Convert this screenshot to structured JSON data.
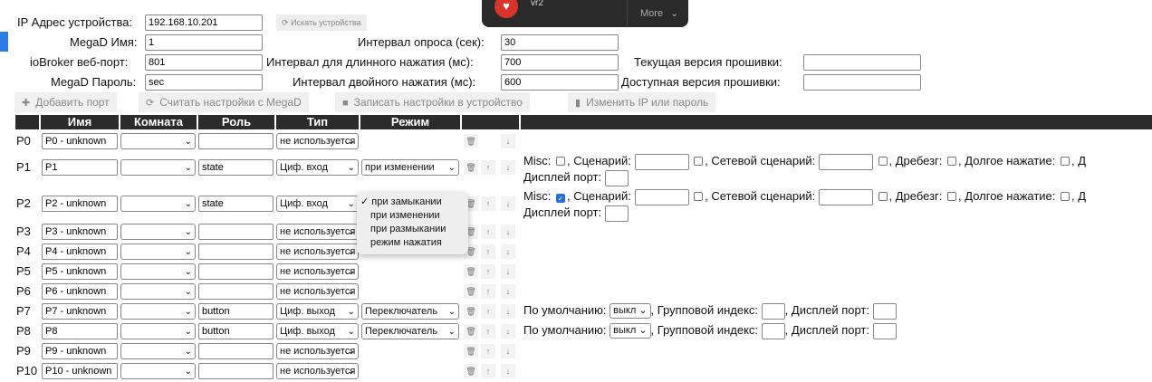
{
  "settings": {
    "ip_label": "IP Адрес устройства:",
    "ip_value": "192.168.10.201",
    "search_label": "Искать устройства",
    "name_label": "MegaD Имя:",
    "name_value": "1",
    "iobroker_label": "ioBroker веб-порт:",
    "iobroker_value": "801",
    "password_label": "MegaD Пароль:",
    "password_value": "sec",
    "poll_label": "Интервал опроса (сек):",
    "poll_value": "30",
    "long_label": "Интервал для длинного нажатия (мс):",
    "long_value": "700",
    "double_label": "Интервал двойного нажатия (мс):",
    "double_value": "600",
    "fw_current_label": "Текущая версия прошивки:",
    "fw_current_value": "",
    "fw_available_label": "Доступная версия прошивки:",
    "fw_available_value": ""
  },
  "toolbar": {
    "add_port": "Добавить порт",
    "read_settings": "Считать настройки с MegaD",
    "write_settings": "Записать настройки в устройство",
    "change_ip": "Изменить IP или пароль"
  },
  "notification": {
    "title": "vr2",
    "more": "More"
  },
  "table": {
    "headers": [
      "Имя",
      "Комната",
      "Роль",
      "Тип",
      "Режим"
    ],
    "rows": [
      {
        "port": "P0",
        "name": "P0 - unknown",
        "role": "",
        "type": "не используется",
        "mode": ""
      },
      {
        "port": "P1",
        "name": "P1",
        "role": "state",
        "type": "Циф. вход",
        "mode": "при изменении"
      },
      {
        "port": "P2",
        "name": "P2 - unknown",
        "role": "state",
        "type": "Циф. вход",
        "mode": ""
      },
      {
        "port": "P3",
        "name": "P3 - unknown",
        "role": "",
        "type": "не используется",
        "mode": ""
      },
      {
        "port": "P4",
        "name": "P4 - unknown",
        "role": "",
        "type": "не используется",
        "mode": ""
      },
      {
        "port": "P5",
        "name": "P5 - unknown",
        "role": "",
        "type": "не используется",
        "mode": ""
      },
      {
        "port": "P6",
        "name": "P6 - unknown",
        "role": "",
        "type": "не используется",
        "mode": ""
      },
      {
        "port": "P7",
        "name": "P7 - unknown",
        "role": "button",
        "type": "Циф. выход",
        "mode": "Переключатель"
      },
      {
        "port": "P8",
        "name": "P8",
        "role": "button",
        "type": "Циф. выход",
        "mode": "Переключатель"
      },
      {
        "port": "P9",
        "name": "P9 - unknown",
        "role": "",
        "type": "не используется",
        "mode": ""
      },
      {
        "port": "P10",
        "name": "P10 - unknown",
        "role": "",
        "type": "не используется",
        "mode": ""
      }
    ]
  },
  "extra": {
    "misc": "Misc:",
    "scenario": ", Сценарий:",
    "net_scenario": ", Сетевой сценарий:",
    "bounce": ", Дребезг:",
    "long_press": ", Долгое нажатие:",
    "long_press_cut": ", Д",
    "display_port": "Дисплей порт:",
    "default_label": "По умолчанию:",
    "default_value": "выкл",
    "group_index": ", Групповой индекс:",
    "display_port2": ", Дисплей порт:"
  },
  "dropdown": {
    "options": [
      "при замыкании",
      "при изменении",
      "при размыкании",
      "режим нажатия"
    ],
    "checkmark": "✓"
  },
  "icons": {
    "delete": "trash-icon",
    "up": "arrow-up-icon",
    "down": "arrow-down-icon"
  }
}
